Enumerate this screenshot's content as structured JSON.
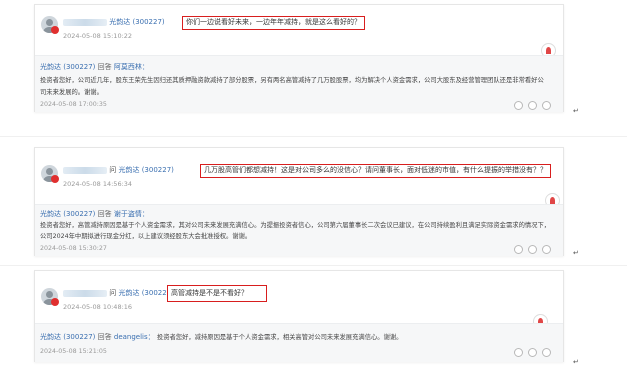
{
  "colors": {
    "link": "#3a6fb0",
    "highlight_box": "#d81e1e",
    "badge": "#e02f2f",
    "answer_bg": "#f6f7f8"
  },
  "posts": [
    {
      "question": {
        "verb": "",
        "company": "光韵达 (300227)",
        "text": "你们一边说看好未来，一边年年减持，就是这么看好的？",
        "date": "2024-05-08 15:10:22"
      },
      "answer": {
        "company": "光韵达 (300227)",
        "reply_word": "回答",
        "user": "阿莫西林：",
        "text": "投资者您好，公司近几年，股东王荣先生因归还其质押融资款减持了部分股票，另有两名高管减持了几万股股票，均为解决个人资金需求，公司大股东及经营管理团队还是非常看好公司未来发展的。谢谢。",
        "date": "2024-05-08 17:00:35"
      }
    },
    {
      "question": {
        "verb": "问",
        "company": "光韵达 (300227)",
        "text": "几万股高管们都想减持！这是对公司多么的没信心？请问董事长，面对低迷的市值，有什么提振的举措没有？？",
        "date": "2024-05-08 14:56:34"
      },
      "answer": {
        "company": "光韵达 (300227)",
        "reply_word": "回答",
        "user": "谢于盗情：",
        "text": "投资者您好，高管减持原因是基于个人资金需求，其对公司未来发展充满信心。为提振投资者信心，公司第六届董事长二次会议已建议，在公司持续盈利且满足实际资金需求的情况下，公司2024年中期拟进行现金分红，以上建议须经股东大会批准授权。谢谢。",
        "date": "2024-05-08 15:30:27"
      }
    },
    {
      "question": {
        "verb": "问",
        "company": "光韵达 (300227)",
        "text": "高管减持是不是不看好？",
        "date": "2024-05-08 10:48:16"
      },
      "answer": {
        "company": "光韵达 (300227)",
        "reply_word": "回答",
        "user": "deangelis：",
        "text": "投资者您好，减持原因是基于个人资金需求，相关高管对公司未来发展充满信心。谢谢。",
        "date": "2024-05-08 15:21:05"
      }
    }
  ],
  "icons": [
    "avatar-icon",
    "verified-badge-icon",
    "follow-flag-icon",
    "like-icon",
    "comment-icon",
    "share-icon"
  ]
}
